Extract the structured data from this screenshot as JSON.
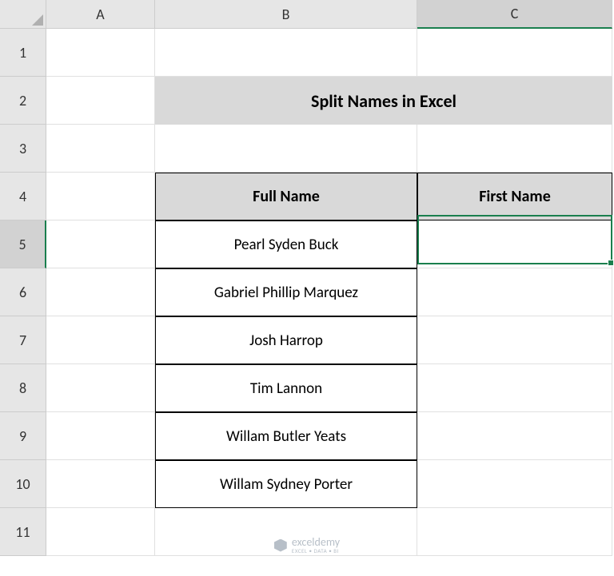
{
  "columns": [
    "A",
    "B",
    "C"
  ],
  "rows": [
    "1",
    "2",
    "3",
    "4",
    "5",
    "6",
    "7",
    "8",
    "9",
    "10",
    "11"
  ],
  "title": "Split Names in Excel",
  "headers": {
    "full_name": "Full Name",
    "first_name": "First Name"
  },
  "data": {
    "names": [
      "Pearl Syden Buck",
      "Gabriel Phillip Marquez",
      "Josh Harrop",
      "Tim Lannon",
      "Willam Butler Yeats",
      "Willam Sydney Porter"
    ]
  },
  "active_cell": "C5",
  "watermark": {
    "brand": "exceldemy",
    "tagline": "EXCEL • DATA • BI"
  }
}
